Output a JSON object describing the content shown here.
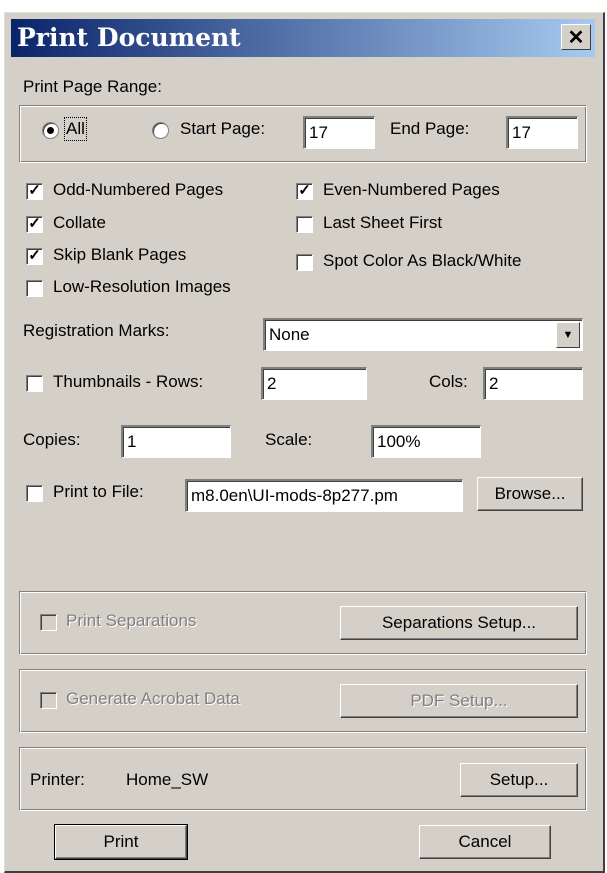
{
  "window": {
    "title": "Print Document",
    "close_symbol": "✕"
  },
  "page_range": {
    "label": "Print Page Range:",
    "all_label": "All",
    "all_selected": true,
    "start_label": "Start Page:",
    "start_value": "17",
    "end_label": "End Page:",
    "end_value": "17"
  },
  "options": {
    "odd_label": "Odd-Numbered Pages",
    "odd_checked": true,
    "even_label": "Even-Numbered Pages",
    "even_checked": true,
    "collate_label": "Collate",
    "collate_checked": true,
    "last_sheet_label": "Last Sheet First",
    "last_sheet_checked": false,
    "skip_blank_label": "Skip Blank Pages",
    "skip_blank_checked": true,
    "spot_color_label": "Spot Color As Black/White",
    "spot_color_checked": false,
    "low_res_label": "Low-Resolution Images",
    "low_res_checked": false
  },
  "registration": {
    "label": "Registration Marks:",
    "value": "None",
    "arrow": "▼"
  },
  "thumbnails": {
    "label": "Thumbnails - Rows:",
    "checked": false,
    "rows_value": "2",
    "cols_label": "Cols:",
    "cols_value": "2"
  },
  "copies": {
    "label": "Copies:",
    "value": "1"
  },
  "scale": {
    "label": "Scale:",
    "value": "100%"
  },
  "print_to_file": {
    "label": "Print to File:",
    "checked": false,
    "value": "m8.0en\\UI-mods-8p277.pm",
    "browse_label": "Browse..."
  },
  "separations": {
    "label": "Print Separations",
    "setup_label": "Separations Setup..."
  },
  "acrobat": {
    "label": "Generate Acrobat Data",
    "setup_label": "PDF Setup..."
  },
  "printer": {
    "label": "Printer:",
    "name": "Home_SW",
    "setup_label": "Setup..."
  },
  "buttons": {
    "print_label": "Print",
    "cancel_label": "Cancel"
  },
  "colors": {
    "title_start": "#0a246a",
    "title_end": "#a6caf0",
    "face": "#d4d0c8"
  }
}
